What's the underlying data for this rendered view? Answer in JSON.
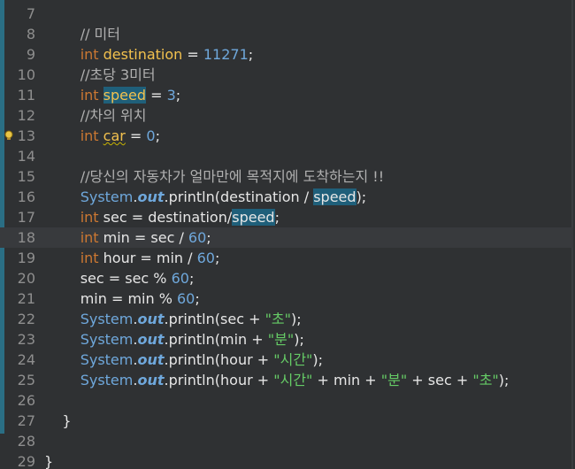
{
  "lines": [
    {
      "num": "7",
      "tokens": []
    },
    {
      "num": "8",
      "tokens": [
        {
          "t": "        "
        },
        {
          "t": "// 미터",
          "c": "cmt"
        }
      ]
    },
    {
      "num": "9",
      "tokens": [
        {
          "t": "        "
        },
        {
          "t": "int",
          "c": "kw"
        },
        {
          "t": " "
        },
        {
          "t": "destination",
          "c": "var"
        },
        {
          "t": " = "
        },
        {
          "t": "11271",
          "c": "num"
        },
        {
          "t": ";"
        }
      ]
    },
    {
      "num": "10",
      "tokens": [
        {
          "t": "        "
        },
        {
          "t": "//초당 3미터",
          "c": "cmt"
        }
      ]
    },
    {
      "num": "11",
      "tokens": [
        {
          "t": "        "
        },
        {
          "t": "int",
          "c": "kw"
        },
        {
          "t": " "
        },
        {
          "t": "speed",
          "c": "var",
          "hl": true
        },
        {
          "t": " = "
        },
        {
          "t": "3",
          "c": "num"
        },
        {
          "t": ";"
        }
      ]
    },
    {
      "num": "12",
      "tokens": [
        {
          "t": "        "
        },
        {
          "t": "//차의 위치",
          "c": "cmt"
        }
      ]
    },
    {
      "num": "13",
      "tokens": [
        {
          "t": "        "
        },
        {
          "t": "int",
          "c": "kw"
        },
        {
          "t": " "
        },
        {
          "t": "car",
          "c": "var",
          "sq": true
        },
        {
          "t": " = "
        },
        {
          "t": "0",
          "c": "num"
        },
        {
          "t": ";"
        }
      ]
    },
    {
      "num": "14",
      "tokens": []
    },
    {
      "num": "15",
      "tokens": [
        {
          "t": "        "
        },
        {
          "t": "//당신의 자동차가 얼마만에 목적지에 도착하는지 !!",
          "c": "cmt"
        }
      ]
    },
    {
      "num": "16",
      "tokens": [
        {
          "t": "        "
        },
        {
          "t": "System",
          "c": "cls"
        },
        {
          "t": "."
        },
        {
          "t": "out",
          "c": "fld"
        },
        {
          "t": "."
        },
        {
          "t": "println",
          "c": "mth"
        },
        {
          "t": "(destination / "
        },
        {
          "t": "speed",
          "hl": true
        },
        {
          "t": ");"
        }
      ]
    },
    {
      "num": "17",
      "tokens": [
        {
          "t": "        "
        },
        {
          "t": "int",
          "c": "kw"
        },
        {
          "t": " sec = destination/"
        },
        {
          "t": "speed",
          "hl": true
        },
        {
          "t": ";"
        }
      ]
    },
    {
      "num": "18",
      "current": true,
      "tokens": [
        {
          "t": "        "
        },
        {
          "t": "int",
          "c": "kw"
        },
        {
          "t": " min = sec / "
        },
        {
          "t": "60",
          "c": "num"
        },
        {
          "t": ";"
        }
      ]
    },
    {
      "num": "19",
      "tokens": [
        {
          "t": "        "
        },
        {
          "t": "int",
          "c": "kw"
        },
        {
          "t": " hour = min / "
        },
        {
          "t": "60",
          "c": "num"
        },
        {
          "t": ";"
        }
      ]
    },
    {
      "num": "20",
      "tokens": [
        {
          "t": "        sec = sec % "
        },
        {
          "t": "60",
          "c": "num"
        },
        {
          "t": ";"
        }
      ]
    },
    {
      "num": "21",
      "tokens": [
        {
          "t": "        min = min % "
        },
        {
          "t": "60",
          "c": "num"
        },
        {
          "t": ";"
        }
      ]
    },
    {
      "num": "22",
      "tokens": [
        {
          "t": "        "
        },
        {
          "t": "System",
          "c": "cls"
        },
        {
          "t": "."
        },
        {
          "t": "out",
          "c": "fld"
        },
        {
          "t": "."
        },
        {
          "t": "println",
          "c": "mth"
        },
        {
          "t": "(sec + "
        },
        {
          "t": "\"초\"",
          "c": "str"
        },
        {
          "t": ");"
        }
      ]
    },
    {
      "num": "23",
      "tokens": [
        {
          "t": "        "
        },
        {
          "t": "System",
          "c": "cls"
        },
        {
          "t": "."
        },
        {
          "t": "out",
          "c": "fld"
        },
        {
          "t": "."
        },
        {
          "t": "println",
          "c": "mth"
        },
        {
          "t": "(min + "
        },
        {
          "t": "\"분\"",
          "c": "str"
        },
        {
          "t": ");"
        }
      ]
    },
    {
      "num": "24",
      "tokens": [
        {
          "t": "        "
        },
        {
          "t": "System",
          "c": "cls"
        },
        {
          "t": "."
        },
        {
          "t": "out",
          "c": "fld"
        },
        {
          "t": "."
        },
        {
          "t": "println",
          "c": "mth"
        },
        {
          "t": "(hour + "
        },
        {
          "t": "\"시간\"",
          "c": "str"
        },
        {
          "t": ");"
        }
      ]
    },
    {
      "num": "25",
      "tokens": [
        {
          "t": "        "
        },
        {
          "t": "System",
          "c": "cls"
        },
        {
          "t": "."
        },
        {
          "t": "out",
          "c": "fld"
        },
        {
          "t": "."
        },
        {
          "t": "println",
          "c": "mth"
        },
        {
          "t": "(hour + "
        },
        {
          "t": "\"시간\"",
          "c": "str"
        },
        {
          "t": " + min + "
        },
        {
          "t": "\"분\"",
          "c": "str"
        },
        {
          "t": " + sec + "
        },
        {
          "t": "\"초\"",
          "c": "str"
        },
        {
          "t": ");"
        }
      ]
    },
    {
      "num": "26",
      "tokens": []
    },
    {
      "num": "27",
      "tokens": [
        {
          "t": "    }"
        }
      ]
    },
    {
      "num": "28",
      "tokens": []
    },
    {
      "num": "29",
      "tokens": [
        {
          "t": "}"
        }
      ]
    }
  ],
  "warning_icon": "warning-lightbulb-icon",
  "colors": {
    "background": "#2f3133",
    "keyword": "#cc7832",
    "variable": "#f2c14e",
    "number": "#6fa8dc",
    "string": "#66cc66",
    "highlight": "#1f5f7a"
  }
}
